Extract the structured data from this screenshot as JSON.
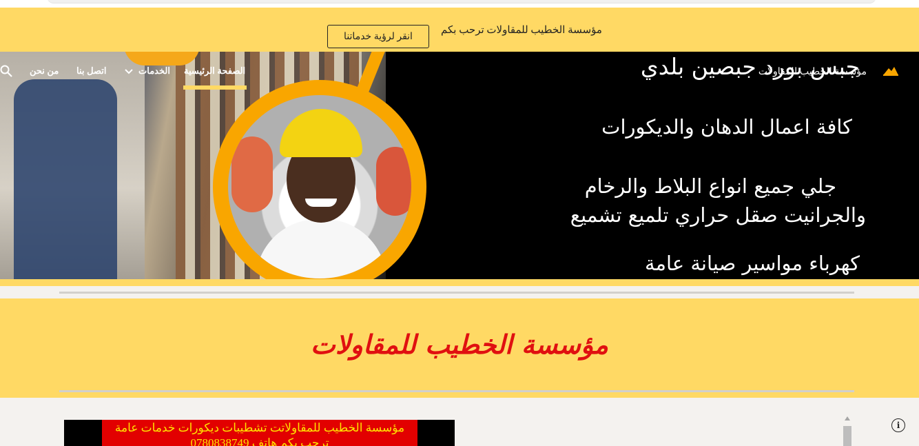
{
  "announcement": {
    "text": "مؤسسة الخطيب للمقاولات ترحب بكم",
    "button_label": "انقر لرؤية خدماتنا"
  },
  "nav": {
    "site_name": "مؤسسة الخطيب للمقاولات",
    "items": [
      {
        "label": "الصفحة الرئيسية",
        "active": true
      },
      {
        "label": "الخدمات",
        "has_dropdown": true
      },
      {
        "label": "اتصل بنا"
      },
      {
        "label": "من نحن"
      }
    ],
    "search_icon": "search-icon",
    "logo_icon": "logo-icon"
  },
  "hero": {
    "lines": [
      "جبس بورد جبصين بلدي",
      "كافة اعمال الدهان والديكورات",
      "جلي جميع انواع البلاط والرخام",
      "والجرانيت صقل حراري تلميع تشميع",
      "كهرباء  مواسير  صيانة عامة"
    ]
  },
  "section": {
    "title": "مؤسسة الخطيب للمقاولات"
  },
  "banner": {
    "line1": "مؤسسة الخطيب للمقاولاتت تشطيبات  ديكورات خدمات عامة",
    "line2": "ترحب بكم هاتف 0780838749"
  },
  "colors": {
    "accent_yellow": "#ffd964",
    "hero_orange": "#f9a600",
    "title_red": "#e01010"
  }
}
